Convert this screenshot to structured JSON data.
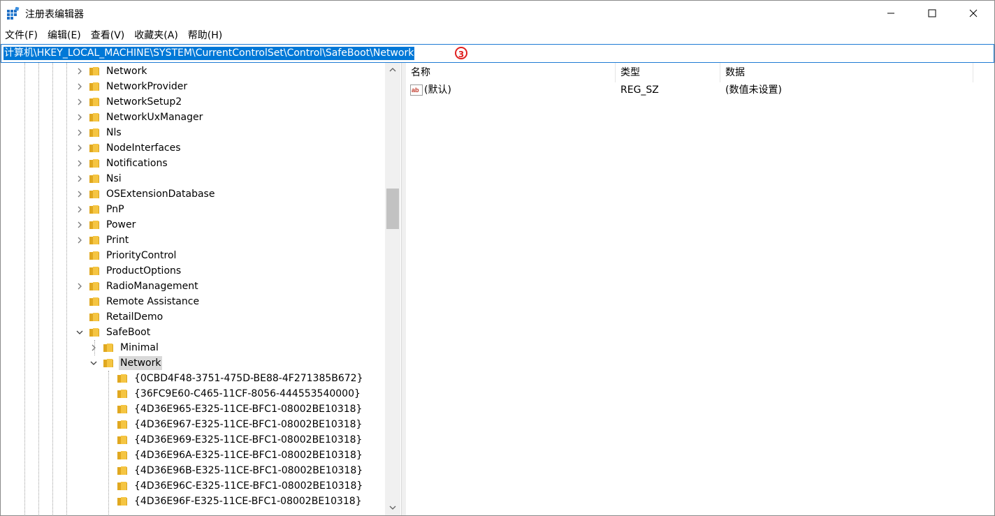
{
  "window": {
    "title": "注册表编辑器",
    "icon": "registry-editor-icon"
  },
  "menu": [
    "文件(F)",
    "编辑(E)",
    "查看(V)",
    "收藏夹(A)",
    "帮助(H)"
  ],
  "address": {
    "path": "计算机\\HKEY_LOCAL_MACHINE\\SYSTEM\\CurrentControlSet\\Control\\SafeBoot\\Network",
    "marker": "3"
  },
  "tree": [
    {
      "label": "Network",
      "chevron": "right"
    },
    {
      "label": "NetworkProvider",
      "chevron": "right"
    },
    {
      "label": "NetworkSetup2",
      "chevron": "right"
    },
    {
      "label": "NetworkUxManager",
      "chevron": "right"
    },
    {
      "label": "Nls",
      "chevron": "right"
    },
    {
      "label": "NodeInterfaces",
      "chevron": "right"
    },
    {
      "label": "Notifications",
      "chevron": "right"
    },
    {
      "label": "Nsi",
      "chevron": "right"
    },
    {
      "label": "OSExtensionDatabase",
      "chevron": "right"
    },
    {
      "label": "PnP",
      "chevron": "right"
    },
    {
      "label": "Power",
      "chevron": "right"
    },
    {
      "label": "Print",
      "chevron": "right"
    },
    {
      "label": "PriorityControl",
      "chevron": "none"
    },
    {
      "label": "ProductOptions",
      "chevron": "none"
    },
    {
      "label": "RadioManagement",
      "chevron": "right"
    },
    {
      "label": "Remote Assistance",
      "chevron": "none"
    },
    {
      "label": "RetailDemo",
      "chevron": "none"
    },
    {
      "label": "SafeBoot",
      "chevron": "down"
    },
    {
      "label": "Minimal",
      "chevron": "right"
    },
    {
      "label": "Network",
      "chevron": "down",
      "selected": true
    },
    {
      "label": "{0CBD4F48-3751-475D-BE88-4F271385B672}",
      "chevron": "none"
    },
    {
      "label": "{36FC9E60-C465-11CF-8056-444553540000}",
      "chevron": "none"
    },
    {
      "label": "{4D36E965-E325-11CE-BFC1-08002BE10318}",
      "chevron": "none"
    },
    {
      "label": "{4D36E967-E325-11CE-BFC1-08002BE10318}",
      "chevron": "none"
    },
    {
      "label": "{4D36E969-E325-11CE-BFC1-08002BE10318}",
      "chevron": "none"
    },
    {
      "label": "{4D36E96A-E325-11CE-BFC1-08002BE10318}",
      "chevron": "none"
    },
    {
      "label": "{4D36E96B-E325-11CE-BFC1-08002BE10318}",
      "chevron": "none"
    },
    {
      "label": "{4D36E96C-E325-11CE-BFC1-08002BE10318}",
      "chevron": "none"
    },
    {
      "label": "{4D36E96F-E325-11CE-BFC1-08002BE10318}",
      "chevron": "none"
    }
  ],
  "columns": {
    "name": "名称",
    "type": "类型",
    "data": "数据"
  },
  "values": [
    {
      "name": "(默认)",
      "type": "REG_SZ",
      "data": "(数值未设置)",
      "icon": "string-value-icon"
    }
  ],
  "colors": {
    "selection": "#0078d7",
    "folder": "#f5c542",
    "marker": "#e02020"
  }
}
